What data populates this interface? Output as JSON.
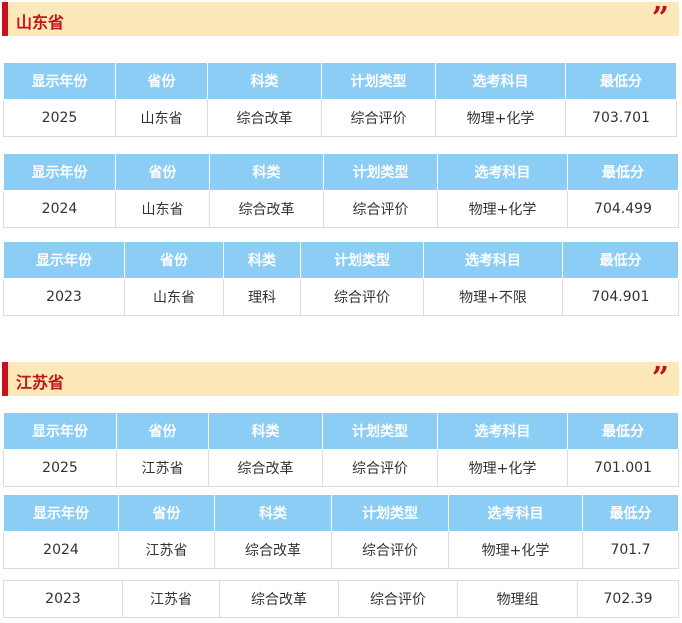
{
  "sections": [
    {
      "title": "山东省",
      "tables": [
        {
          "headers": [
            "显示年份",
            "省份",
            "科类",
            "计划类型",
            "选考科目",
            "最低分"
          ],
          "row": [
            "2025",
            "山东省",
            "综合改革",
            "综合评价",
            "物理+化学",
            "703.701"
          ]
        },
        {
          "headers": [
            "显示年份",
            "省份",
            "科类",
            "计划类型",
            "选考科目",
            "最低分"
          ],
          "row": [
            "2024",
            "山东省",
            "综合改革",
            "综合评价",
            "物理+化学",
            "704.499"
          ]
        },
        {
          "headers": [
            "显示年份",
            "省份",
            "科类",
            "计划类型",
            "选考科目",
            "最低分"
          ],
          "row": [
            "2023",
            "山东省",
            "理科",
            "综合评价",
            "物理+不限",
            "704.901"
          ]
        }
      ]
    },
    {
      "title": "江苏省",
      "tables": [
        {
          "headers": [
            "显示年份",
            "省份",
            "科类",
            "计划类型",
            "选考科目",
            "最低分"
          ],
          "row": [
            "2025",
            "江苏省",
            "综合改革",
            "综合评价",
            "物理+化学",
            "701.001"
          ]
        },
        {
          "headers": [
            "显示年份",
            "省份",
            "科类",
            "计划类型",
            "选考科目",
            "最低分"
          ],
          "row": [
            "2024",
            "江苏省",
            "综合改革",
            "综合评价",
            "物理+化学",
            "701.7"
          ]
        },
        {
          "headers": [],
          "row": [
            "2023",
            "江苏省",
            "综合改革",
            "综合评价",
            "物理组",
            "702.39"
          ]
        }
      ]
    }
  ],
  "colors": {
    "header_bar": "#fde9b8",
    "accent_red": "#c0141c",
    "table_head": "#8ccdf5"
  },
  "icons": {
    "section_marker": "quote-mark-icon"
  }
}
